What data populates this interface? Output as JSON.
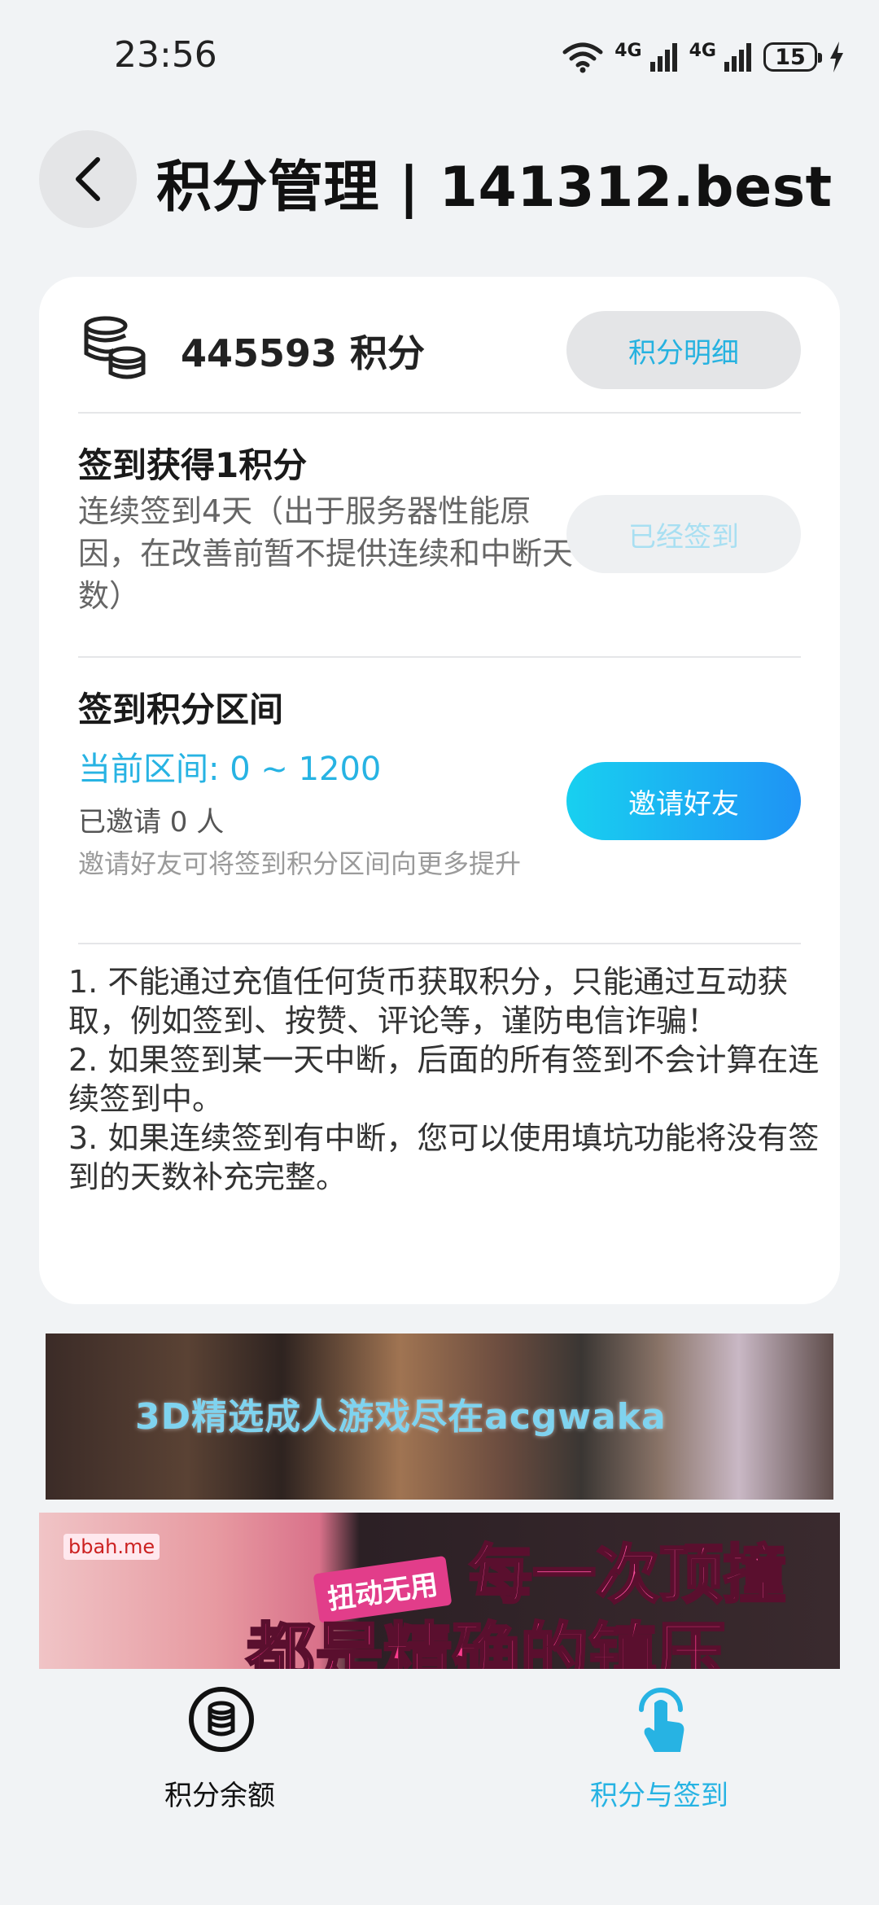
{
  "status_bar": {
    "time": "23:56",
    "signal1": "4G",
    "signal2": "4G",
    "battery": "15"
  },
  "header": {
    "title": "积分管理 | 141312.best"
  },
  "points": {
    "value": "445593 积分",
    "detail_button": "积分明细"
  },
  "signin": {
    "title": "签到获得1积分",
    "description": "连续签到4天（出于服务器性能原因，在改善前暂不提供连续和中断天数）",
    "button": "已经签到"
  },
  "range": {
    "title": "签到积分区间",
    "current": "当前区间:  0 ~ 1200",
    "invited": "已邀请 0 人",
    "hint": "邀请好友可将签到积分区间向更多提升",
    "button": "邀请好友"
  },
  "rules": [
    "1. 不能通过充值任何货币获取积分，只能通过互动获取，例如签到、按赞、评论等，谨防电信诈骗！",
    "2. 如果签到某一天中断，后面的所有签到不会计算在连续签到中。",
    "3. 如果连续签到有中断，您可以使用填坑功能将没有签到的天数补充完整。"
  ],
  "banners": {
    "banner1_text": "3D精选成人游戏尽在acgwaka",
    "banner2_logo": "bbah.me",
    "banner2_tag": "扭动无用",
    "banner2_line1": "每一次顶撞",
    "banner2_line2": "都是精确的镇压"
  },
  "tabbar": {
    "items": [
      {
        "label": "积分余额",
        "icon": "database-coin-icon",
        "active": false
      },
      {
        "label": "积分与签到",
        "icon": "tap-hand-icon",
        "active": true
      }
    ]
  },
  "colors": {
    "accent": "#27b3e3",
    "background": "#f1f3f5",
    "card": "#ffffff"
  }
}
